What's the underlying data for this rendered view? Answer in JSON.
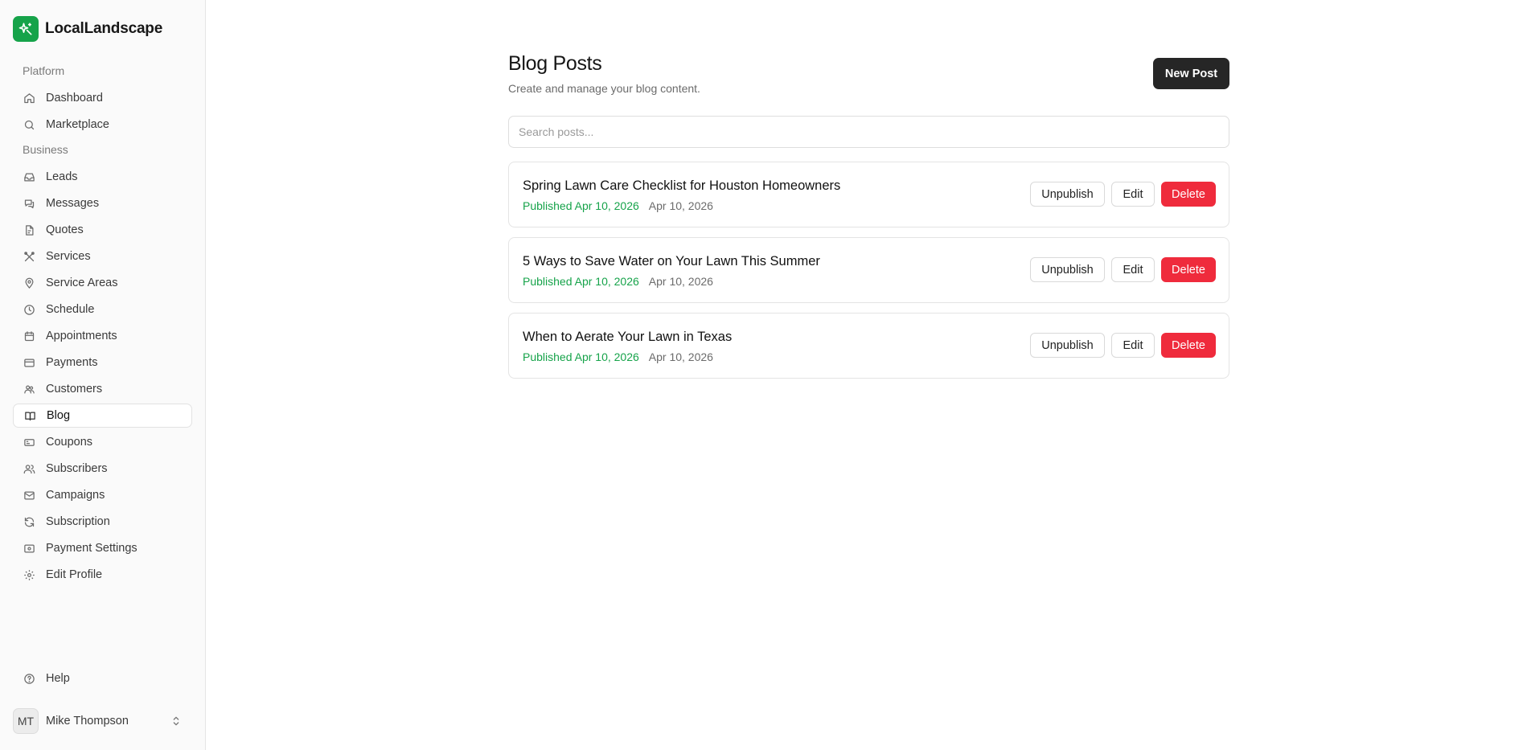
{
  "app": {
    "name": "LocalLandscape"
  },
  "sidebar": {
    "groups": [
      {
        "label": "Platform"
      },
      {
        "label": "Business"
      }
    ],
    "items": [
      {
        "label": "Dashboard",
        "icon": "home-icon"
      },
      {
        "label": "Marketplace",
        "icon": "search-icon"
      },
      {
        "label": "Leads",
        "icon": "inbox-icon"
      },
      {
        "label": "Messages",
        "icon": "chat-icon"
      },
      {
        "label": "Quotes",
        "icon": "file-icon"
      },
      {
        "label": "Services",
        "icon": "tools-icon"
      },
      {
        "label": "Service Areas",
        "icon": "map-pin-icon"
      },
      {
        "label": "Schedule",
        "icon": "clock-icon"
      },
      {
        "label": "Appointments",
        "icon": "calendar-icon"
      },
      {
        "label": "Payments",
        "icon": "credit-card-icon"
      },
      {
        "label": "Customers",
        "icon": "users-handshake-icon"
      },
      {
        "label": "Blog",
        "icon": "book-icon",
        "active": true
      },
      {
        "label": "Coupons",
        "icon": "ticket-icon"
      },
      {
        "label": "Subscribers",
        "icon": "users-icon"
      },
      {
        "label": "Campaigns",
        "icon": "mail-icon"
      },
      {
        "label": "Subscription",
        "icon": "refresh-icon"
      },
      {
        "label": "Payment Settings",
        "icon": "wallet-icon"
      },
      {
        "label": "Edit Profile",
        "icon": "gear-icon"
      }
    ],
    "help": {
      "label": "Help",
      "icon": "help-circle-icon"
    },
    "user": {
      "initials": "MT",
      "name": "Mike Thompson"
    }
  },
  "main": {
    "title": "Blog Posts",
    "subtitle": "Create and manage your blog content.",
    "new_post_label": "New Post",
    "search_placeholder": "Search posts...",
    "posts": [
      {
        "title": "Spring Lawn Care Checklist for Houston Homeowners",
        "status": "Published Apr 10, 2026",
        "date": "Apr 10, 2026"
      },
      {
        "title": "5 Ways to Save Water on Your Lawn This Summer",
        "status": "Published Apr 10, 2026",
        "date": "Apr 10, 2026"
      },
      {
        "title": "When to Aerate Your Lawn in Texas",
        "status": "Published Apr 10, 2026",
        "date": "Apr 10, 2026"
      }
    ],
    "actions": {
      "unpublish": "Unpublish",
      "edit": "Edit",
      "delete": "Delete"
    }
  },
  "colors": {
    "brand": "#16a34a",
    "danger": "#ef2b3c",
    "primary_button": "#262626",
    "published": "#16a34a"
  }
}
